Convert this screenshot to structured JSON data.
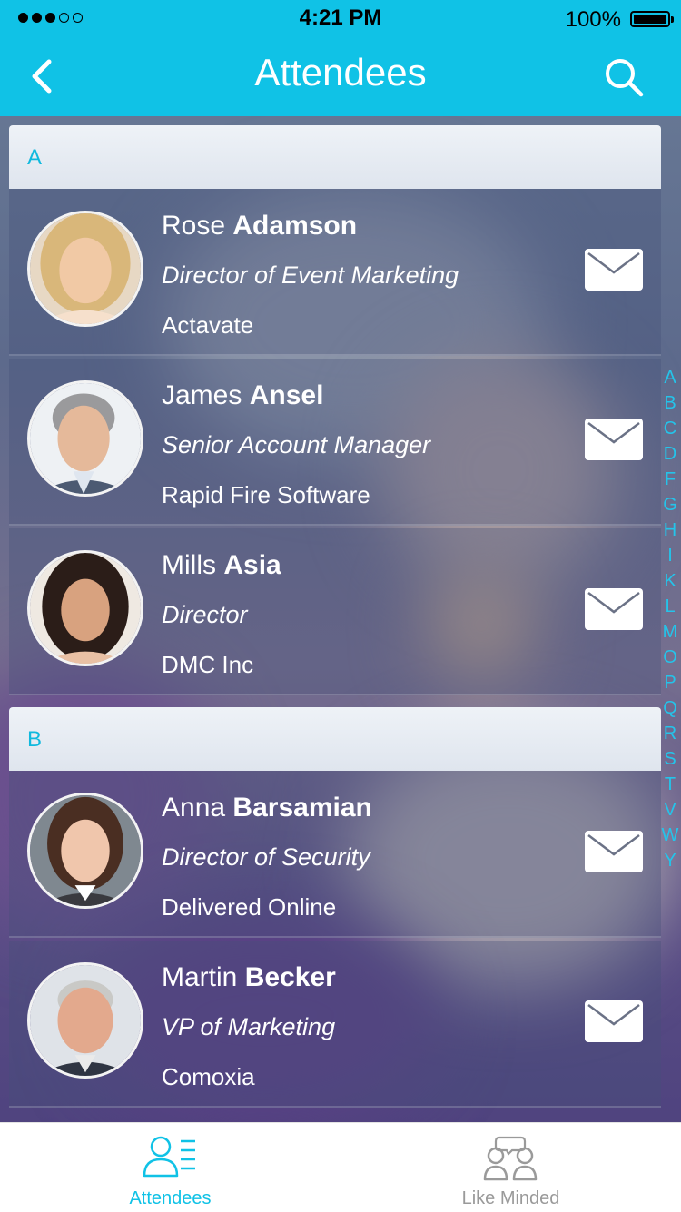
{
  "status_bar": {
    "time": "4:21 PM",
    "battery": "100%"
  },
  "nav": {
    "title": "Attendees",
    "back_icon": "back-chevron-icon",
    "search_icon": "search-icon"
  },
  "sections": [
    {
      "letter": "A",
      "attendees": [
        {
          "first_name": "Rose",
          "last_name": "Adamson",
          "title": "Director of Event Marketing",
          "company": "Actavate"
        },
        {
          "first_name": "James",
          "last_name": "Ansel",
          "title": "Senior Account Manager",
          "company": "Rapid Fire Software"
        },
        {
          "first_name": "Mills",
          "last_name": "Asia",
          "title": "Director",
          "company": "DMC Inc"
        }
      ]
    },
    {
      "letter": "B",
      "attendees": [
        {
          "first_name": "Anna",
          "last_name": "Barsamian",
          "title": "Director of Security",
          "company": "Delivered Online"
        },
        {
          "first_name": "Martin",
          "last_name": "Becker",
          "title": "VP of Marketing",
          "company": "Comoxia"
        }
      ]
    }
  ],
  "alphabet_index": [
    "A",
    "B",
    "C",
    "D",
    "F",
    "G",
    "H",
    "I",
    "K",
    "L",
    "M",
    "O",
    "P",
    "Q",
    "R",
    "S",
    "T",
    "V",
    "W",
    "Y"
  ],
  "tab_bar": {
    "tabs": [
      {
        "label": "Attendees",
        "icon": "attendees-icon",
        "active": true
      },
      {
        "label": "Like Minded",
        "icon": "like-minded-icon",
        "active": false
      }
    ]
  },
  "colors": {
    "accent": "#10c2e6",
    "inactive_tab": "#9a9a9a",
    "index_letters": "#24c4ea"
  }
}
